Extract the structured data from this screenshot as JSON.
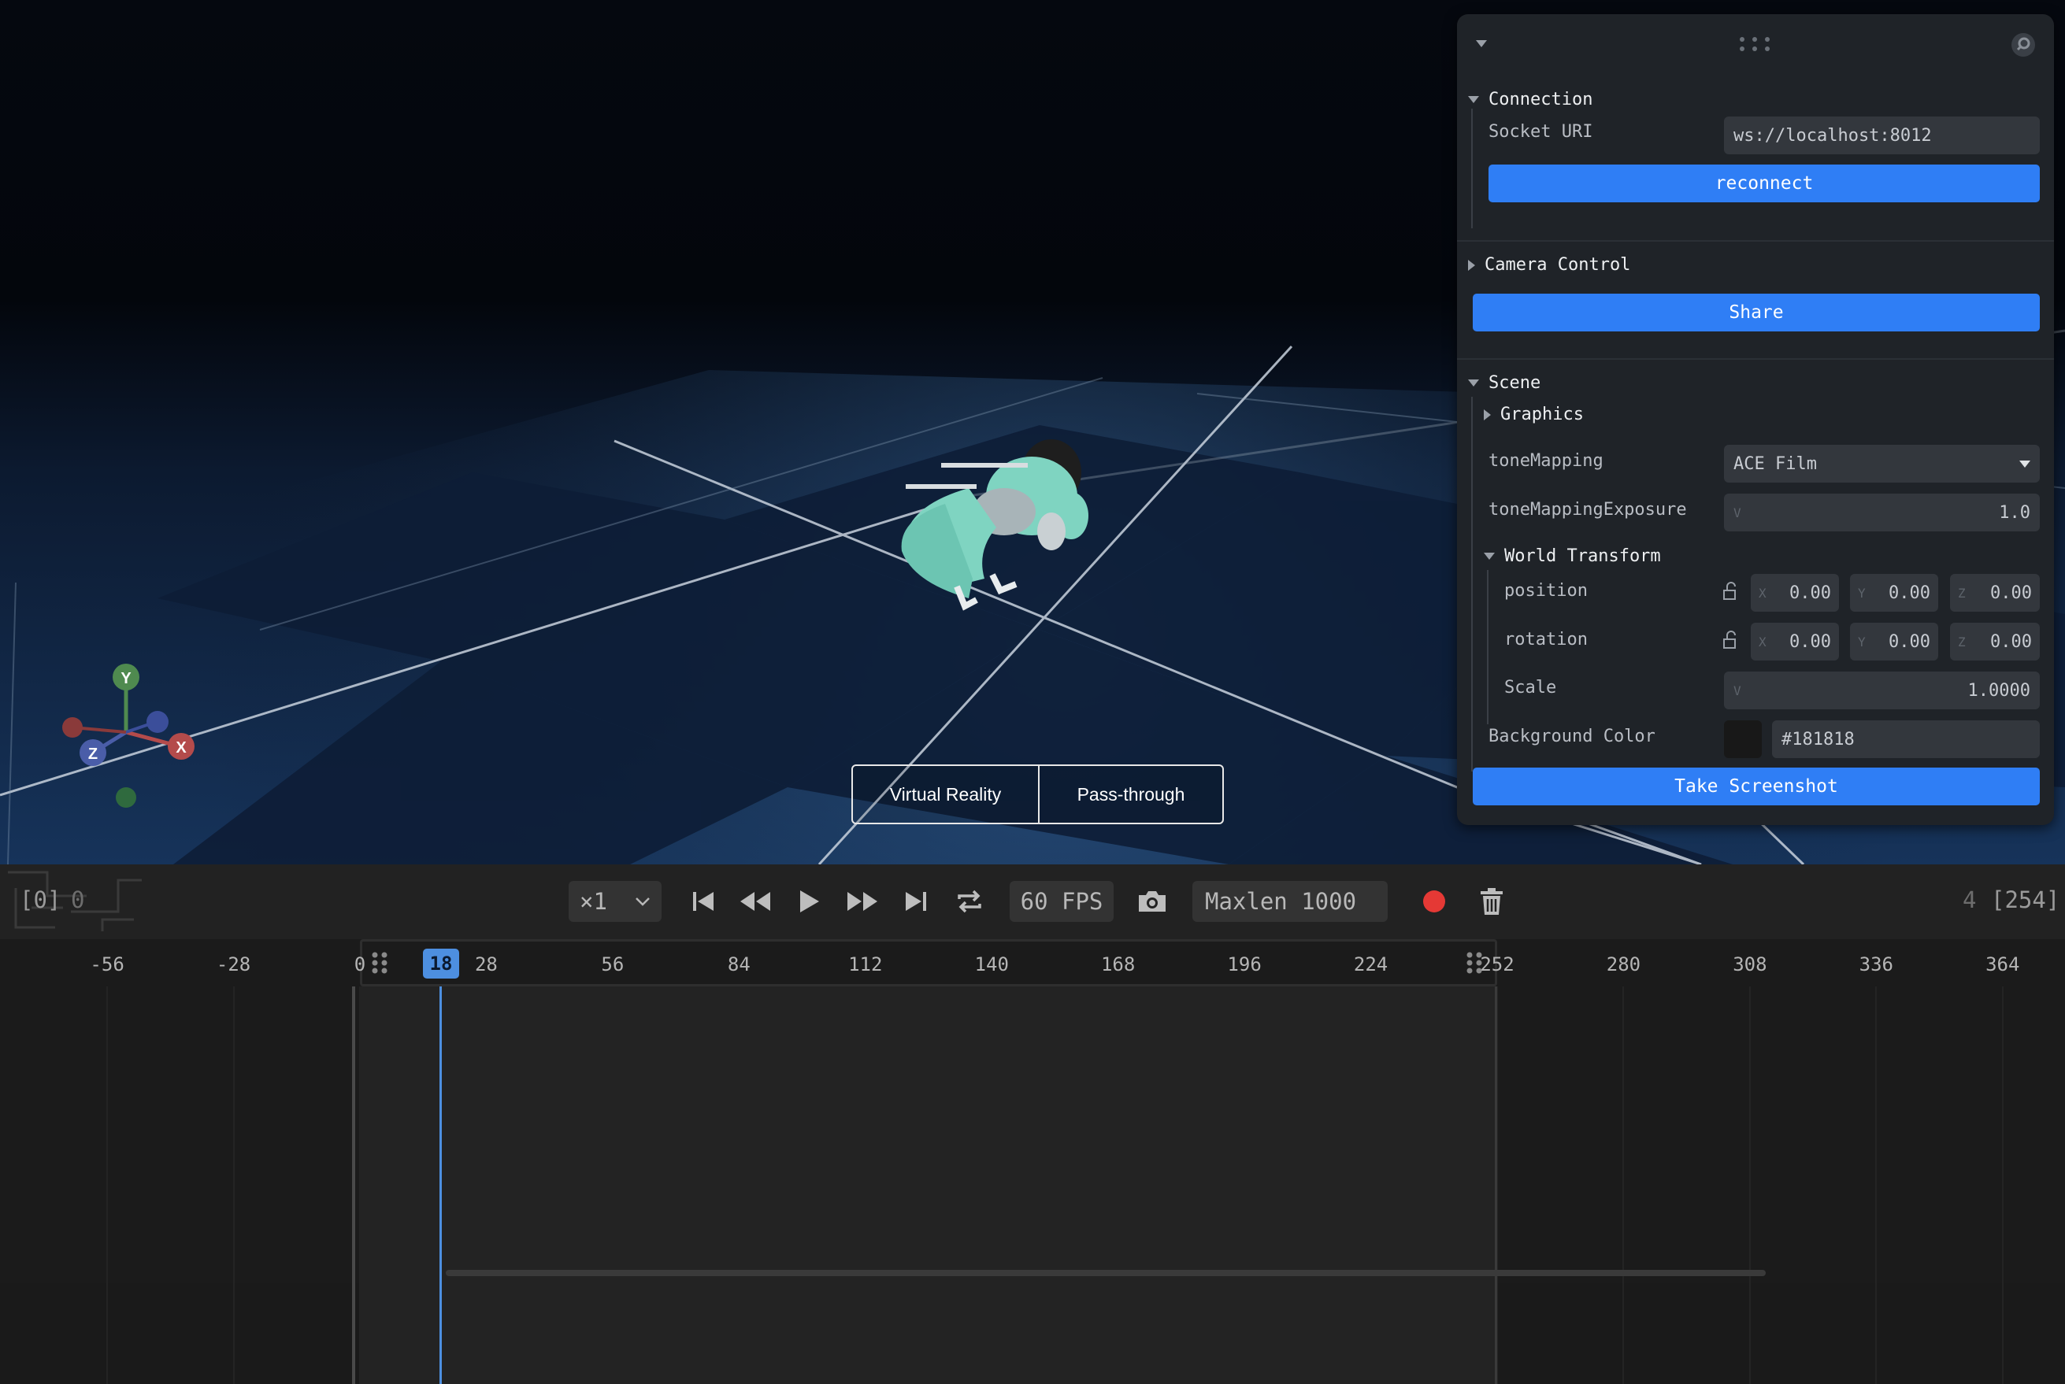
{
  "viewport": {
    "xr_buttons": {
      "virtual_reality": "Virtual Reality",
      "pass_through": "Pass-through"
    },
    "gizmo": {
      "y_label": "Y",
      "x_label": "X",
      "z_label": "Z"
    }
  },
  "panel": {
    "connection": {
      "title": "Connection",
      "socket_uri_label": "Socket URI",
      "socket_uri_value": "ws://localhost:8012",
      "reconnect_label": "reconnect"
    },
    "camera_control": {
      "title": "Camera Control",
      "share_label": "Share"
    },
    "scene": {
      "title": "Scene",
      "graphics_title": "Graphics",
      "tone_mapping_label": "toneMapping",
      "tone_mapping_value": "ACE Film",
      "tone_mapping_exposure_label": "toneMappingExposure",
      "tone_mapping_exposure_tag": "V",
      "tone_mapping_exposure_value": "1.0",
      "world_transform": {
        "title": "World Transform",
        "position_label": "position",
        "position": {
          "x": "0.00",
          "y": "0.00",
          "z": "0.00"
        },
        "rotation_label": "rotation",
        "rotation": {
          "x": "0.00",
          "y": "0.00",
          "z": "0.00"
        },
        "scale_label": "Scale",
        "scale_tag": "V",
        "scale_value": "1.0000"
      },
      "background_color_label": "Background Color",
      "background_color_value": "#181818"
    },
    "take_screenshot_label": "Take Screenshot",
    "axis_tags": {
      "x": "X",
      "y": "Y",
      "z": "Z"
    }
  },
  "playbar": {
    "frame_left": "[0]",
    "frame_left_value": "0",
    "speed": "×1",
    "fps": "60 FPS",
    "maxlen": "Maxlen 1000",
    "frame_right_value": "4",
    "frame_right": "[254]"
  },
  "timeline": {
    "current_frame": "18",
    "ticks": [
      "-56",
      "-28",
      "0",
      "28",
      "56",
      "84",
      "112",
      "140",
      "168",
      "196",
      "224",
      "252",
      "280",
      "308",
      "336",
      "364"
    ]
  },
  "colors": {
    "accent_blue": "#2f7ef5",
    "record_red": "#e53935",
    "panel_bg": "#1f2328",
    "robot_teal": "#7fd4c1"
  }
}
